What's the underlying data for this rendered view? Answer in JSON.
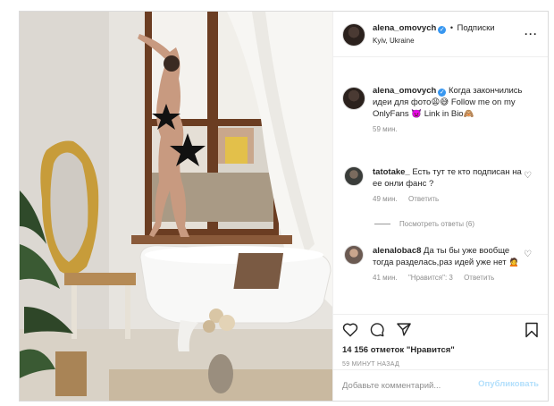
{
  "post": {
    "author": {
      "username": "alena_omovych",
      "follow_label": "Подписки",
      "location": "Kyiv, Ukraine"
    },
    "caption": {
      "username": "alena_omovych",
      "text": "Когда закончились идеи для фото😩😅 Follow me on my OnlyFans 👿 Link in Bio🙈",
      "time": "59 мин."
    },
    "comments": [
      {
        "username": "tatotake_",
        "text": "Есть тут те кто подписан на ее онли фанс ?",
        "time": "49 мин.",
        "reply_label": "Ответить"
      },
      {
        "username": "alenalobac8",
        "text": "Да ты бы уже вообще тогда разделась,раз идей уже нет 🙍",
        "time": "41 мин.",
        "likes_label": "\"Нравится\": 3",
        "reply_label": "Ответить"
      }
    ],
    "view_replies_label": "Посмотреть ответы (6)",
    "likes_text": "14 156 отметок \"Нравится\"",
    "posted_ago": "59 МИНУТ НАЗАД",
    "comment_placeholder": "Добавьте комментарий...",
    "publish_label": "Опубликовать"
  },
  "colors": {
    "accent": "#3897f0",
    "publish_disabled": "#b2dffc",
    "muted": "#8e8e8e",
    "text": "#262626"
  },
  "icons": {
    "verified": "verified-badge-icon",
    "more": "more-options-icon",
    "like": "heart-icon",
    "comment": "comment-icon",
    "share": "share-icon",
    "save": "bookmark-icon"
  }
}
